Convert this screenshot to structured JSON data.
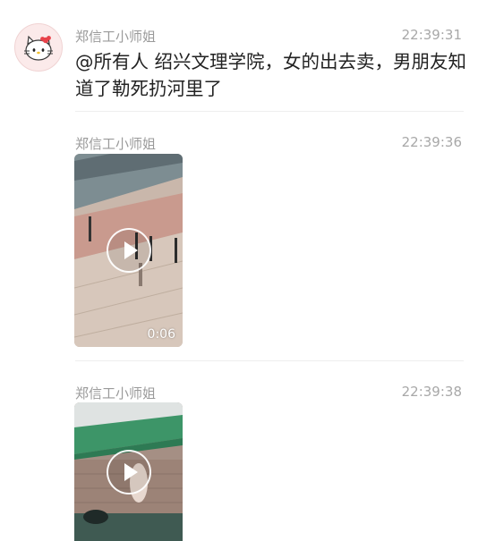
{
  "messages": [
    {
      "sender": "郑信工小师姐",
      "time": "22:39:31",
      "text": "@所有人 绍兴文理学院，女的出去卖，男朋友知道了勒死扔河里了"
    },
    {
      "sender": "郑信工小师姐",
      "time": "22:39:36",
      "video": {
        "duration": "0:06"
      }
    },
    {
      "sender": "郑信工小师姐",
      "time": "22:39:38",
      "video": {}
    }
  ],
  "avatar_icon": "hello-kitty-avatar-icon",
  "play_icon": "play-icon",
  "colors": {
    "sender": "#9a9a9a",
    "time": "#a8a8a8",
    "text": "#222222",
    "divider": "#eeeeee",
    "avatar_bg": "#fbeaea"
  }
}
